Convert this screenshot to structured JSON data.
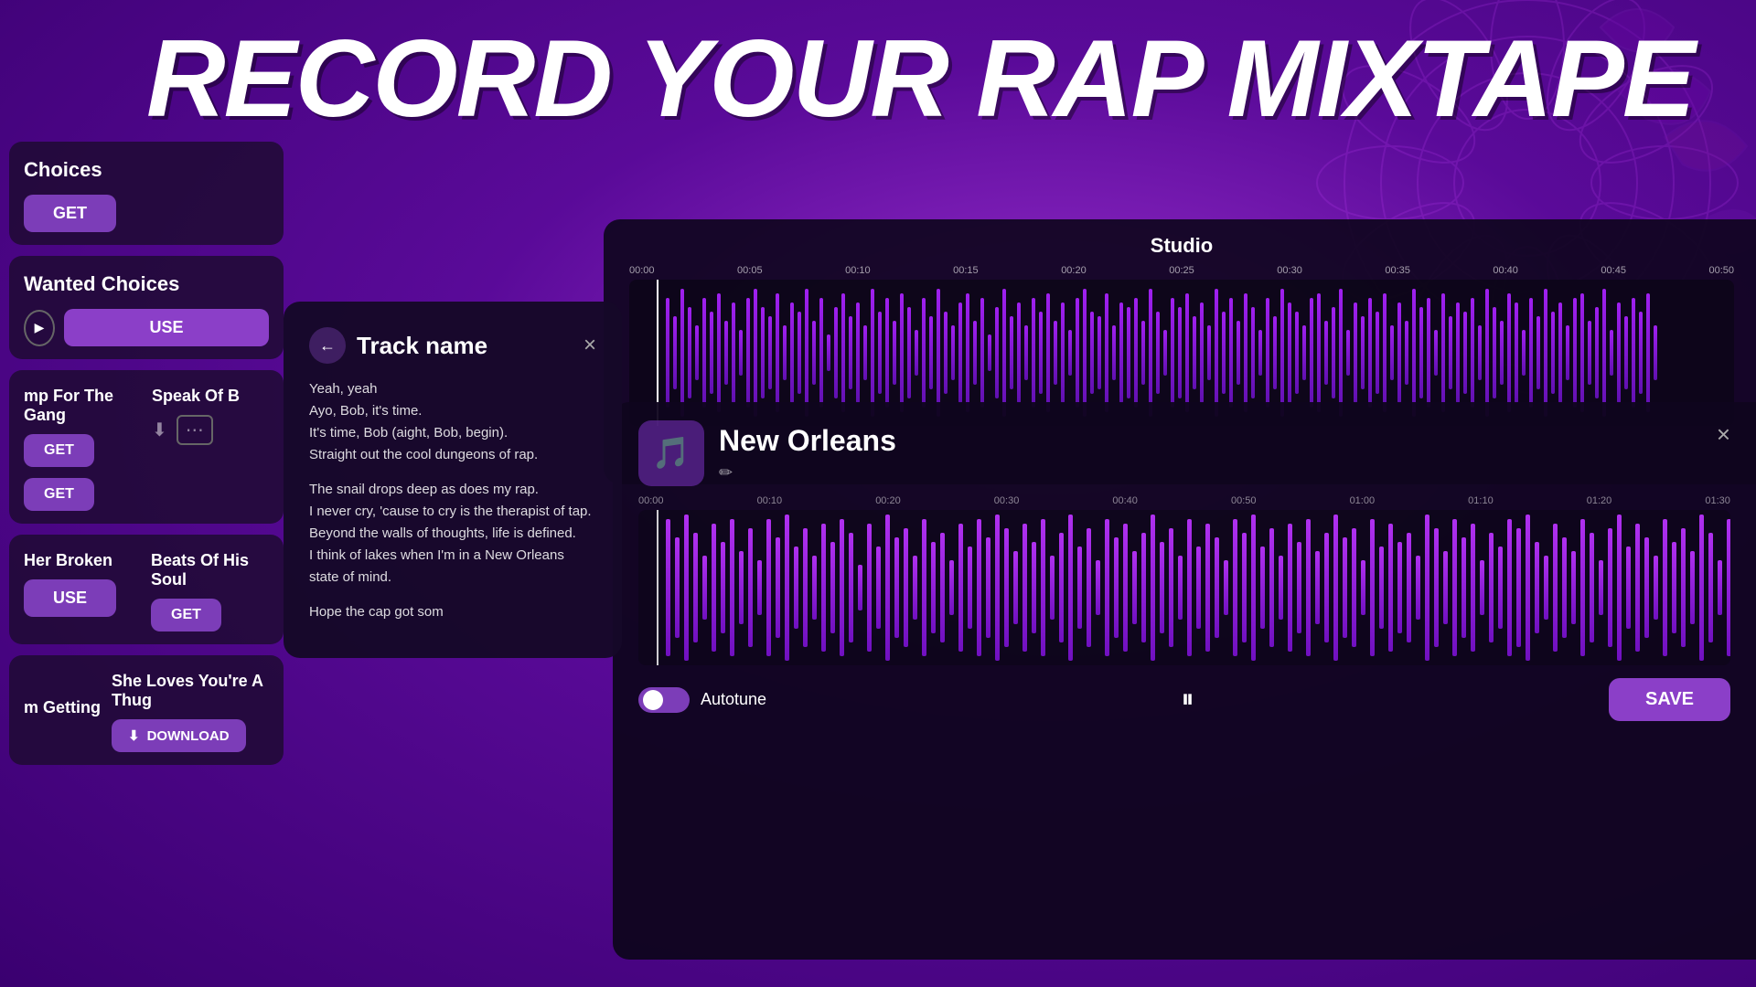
{
  "headline": "RECORD YOUR RAP MIXTAPE",
  "sidebar": {
    "card1": {
      "title": "Choices",
      "button": "GET"
    },
    "card2": {
      "title": "Wanted Choices",
      "use_button": "USE"
    },
    "card3": {
      "title": "Speak Of B",
      "title2": "mp For The Gang",
      "get_button": "GET"
    },
    "card4": {
      "title": "Beats Of His Soul",
      "title2": "Her Broken",
      "get_button": "GET",
      "use_button": "USE"
    },
    "card5": {
      "title": "She Loves You're A Thug",
      "title2": "m Getting",
      "download_button": "DOWNLOAD"
    }
  },
  "track_modal": {
    "title": "Track name",
    "lyrics_1": "Yeah, yeah\nAyo, Bob, it's time.\nIt's time, Bob (aight, Bob, begin).\nStraight out the cool dungeons of rap.",
    "lyrics_2": "The snail drops deep as does my rap.\nI never cry, 'cause to cry is the therapist of tap.\nBeyond the walls of thoughts, life is defined.\nI think of lakes when I'm in a New Orleans state of mind.",
    "lyrics_3": "Hope the cap got som"
  },
  "studio": {
    "title": "Studio",
    "timeline_labels": [
      "00:00",
      "00:05",
      "00:10",
      "00:15",
      "00:20",
      "00:25",
      "00:30",
      "00:35",
      "00:40",
      "00:45",
      "00:50"
    ]
  },
  "recording": {
    "title": "New Orleans",
    "timeline_labels": [
      "00:00",
      "00:10",
      "00:20",
      "00:30",
      "00:40",
      "00:50",
      "01:00",
      "01:10",
      "01:20",
      "01:30"
    ],
    "autotune_label": "Autotune",
    "save_button": "SAVE",
    "pause_icon": "⏸"
  }
}
